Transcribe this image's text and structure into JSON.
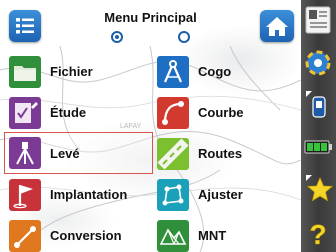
{
  "header": {
    "title": "Menu Principal",
    "page_indicator": {
      "pages": 2,
      "selected": 1
    }
  },
  "menu": {
    "fichier": "Fichier",
    "cogo": "Cogo",
    "etude": "Étude",
    "courbe": "Courbe",
    "leve": "Levé",
    "routes": "Routes",
    "implantation": "Implantation",
    "ajuster": "Ajuster",
    "conversion": "Conversion",
    "mnt": "MNT",
    "selected_item": "leve"
  },
  "map_watermark": "LAFAY",
  "sidebar": {
    "battery_level": 1.0,
    "icons": [
      "instrument-settings-icon",
      "gnss-satellite-icon",
      "receiver-status-icon",
      "battery-icon",
      "favorites-star-icon",
      "help-icon"
    ]
  }
}
